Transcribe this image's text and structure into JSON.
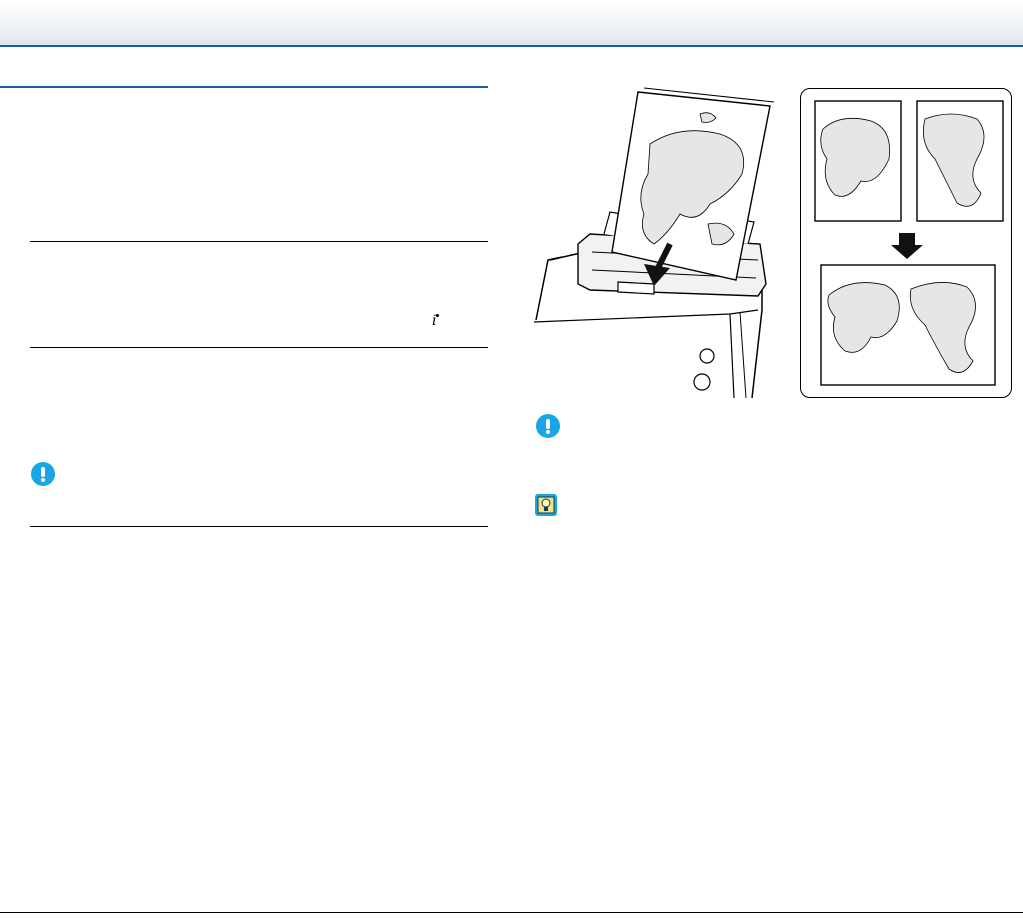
{
  "page": {
    "accent_color": "#1b5ba8",
    "info_glyph": "i"
  },
  "icons": {
    "important_left": "important-icon",
    "important_right": "important-icon",
    "hint": "hint-lightbulb-icon",
    "important_color": "#1aa6e6"
  },
  "figures": {
    "feeding": "scanner-feeding-folded-map",
    "stitching": "two-halves-combined-into-one-map"
  }
}
